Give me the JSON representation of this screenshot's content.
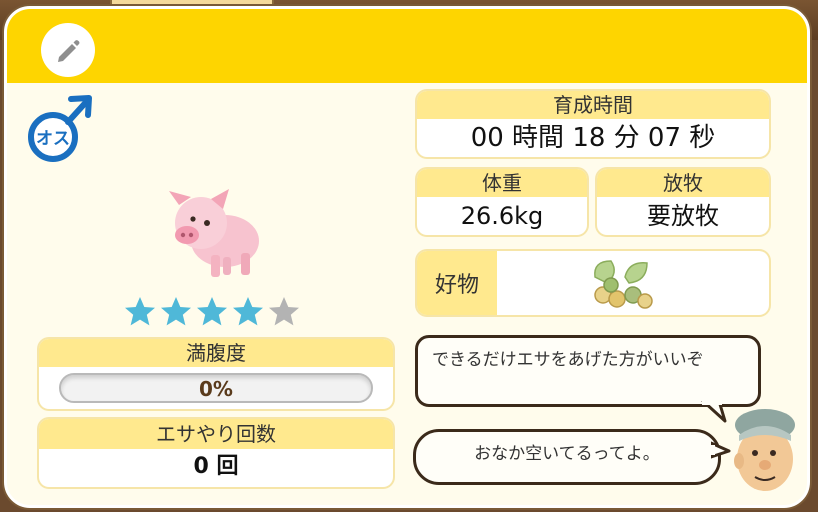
{
  "edit_icon": "pencil-icon",
  "gender": {
    "label": "オス",
    "color": "#1a6fc0"
  },
  "rating": {
    "filled": 4,
    "total": 5,
    "filled_color": "#4fb8d8",
    "empty_color": "#b3b3b3"
  },
  "fullness": {
    "label": "満腹度",
    "value": "0%",
    "percent": 0
  },
  "feed_count": {
    "label": "エサやり回数",
    "value": "0 回"
  },
  "raise_time": {
    "label": "育成時間",
    "value": "00 時間 18 分 07 秒"
  },
  "weight": {
    "label": "体重",
    "value": "26.6kg"
  },
  "grazing": {
    "label": "放牧",
    "value": "要放牧"
  },
  "favorite": {
    "label": "好物",
    "icon": "nuts-leaves-icon"
  },
  "speech": {
    "advice": "できるだけエサをあげた方がいいぞ",
    "hungry": "おなか空いてるってよ。"
  },
  "colors": {
    "header": "#fed500",
    "panel": "#fffcec",
    "box_header": "#ffe98e"
  }
}
